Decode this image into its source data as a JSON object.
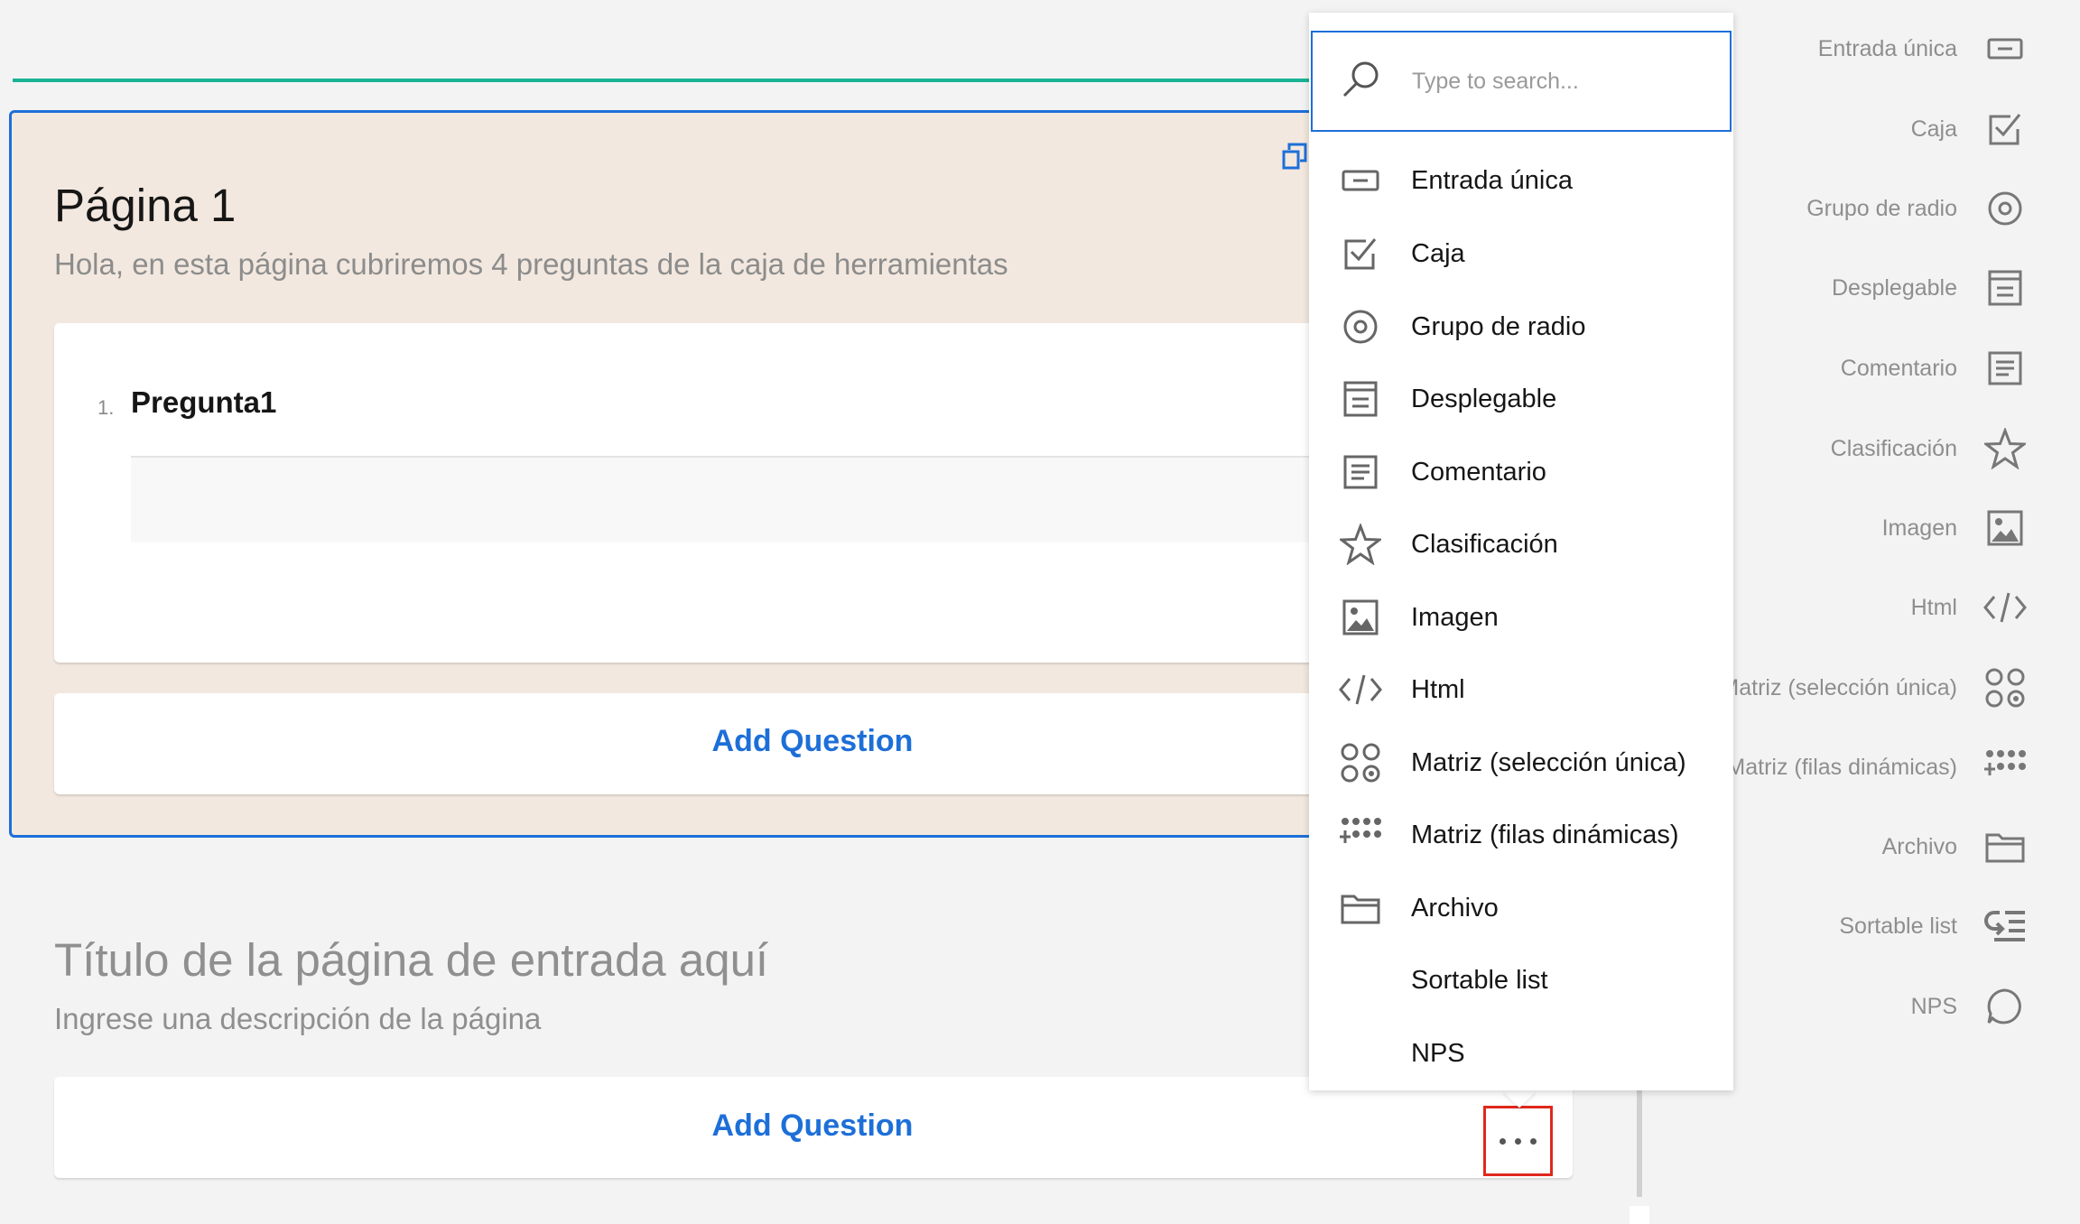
{
  "page1": {
    "title": "Página 1",
    "description": "Hola, en esta página cubriremos 4 preguntas de la caja de herramientas",
    "question": {
      "number": "1.",
      "title": "Pregunta1"
    },
    "add_question": "Add Question"
  },
  "new_page": {
    "title_placeholder": "Título de la página de entrada aquí",
    "description_placeholder": "Ingrese una descripción de la página",
    "add_question": "Add Question"
  },
  "popup": {
    "search_placeholder": "Type to search...",
    "items": [
      {
        "label": "Entrada única",
        "icon": "text-input-icon"
      },
      {
        "label": "Caja",
        "icon": "checkbox-icon"
      },
      {
        "label": "Grupo de radio",
        "icon": "radio-icon"
      },
      {
        "label": "Desplegable",
        "icon": "dropdown-icon"
      },
      {
        "label": "Comentario",
        "icon": "comment-icon"
      },
      {
        "label": "Clasificación",
        "icon": "star-icon"
      },
      {
        "label": "Imagen",
        "icon": "image-icon"
      },
      {
        "label": "Html",
        "icon": "code-icon"
      },
      {
        "label": "Matriz (selección única)",
        "icon": "matrix-icon"
      },
      {
        "label": "Matriz (filas dinámicas)",
        "icon": "matrix-dynamic-icon"
      },
      {
        "label": "Archivo",
        "icon": "folder-icon"
      },
      {
        "label": "Sortable list",
        "icon": ""
      },
      {
        "label": "NPS",
        "icon": ""
      }
    ]
  },
  "toolbox": {
    "items": [
      {
        "label": "Entrada única",
        "icon": "text-input-icon"
      },
      {
        "label": "Caja",
        "icon": "checkbox-icon"
      },
      {
        "label": "Grupo de radio",
        "icon": "radio-icon"
      },
      {
        "label": "Desplegable",
        "icon": "dropdown-icon"
      },
      {
        "label": "Comentario",
        "icon": "comment-icon"
      },
      {
        "label": "Clasificación",
        "icon": "star-icon"
      },
      {
        "label": "Imagen",
        "icon": "image-icon"
      },
      {
        "label": "Html",
        "icon": "code-icon"
      },
      {
        "label": "Matriz (selección única)",
        "icon": "matrix-icon"
      },
      {
        "label": "Matriz (filas dinámicas)",
        "icon": "matrix-dynamic-icon"
      },
      {
        "label": "Archivo",
        "icon": "folder-icon"
      },
      {
        "label": "Sortable list",
        "icon": "sortable-list-icon"
      },
      {
        "label": "NPS",
        "icon": "nps-icon"
      }
    ]
  },
  "colors": {
    "accent": "#1d6fd8",
    "teal": "#19b394",
    "page_background": "#f2e8df",
    "highlight_border": "#e0281d"
  }
}
